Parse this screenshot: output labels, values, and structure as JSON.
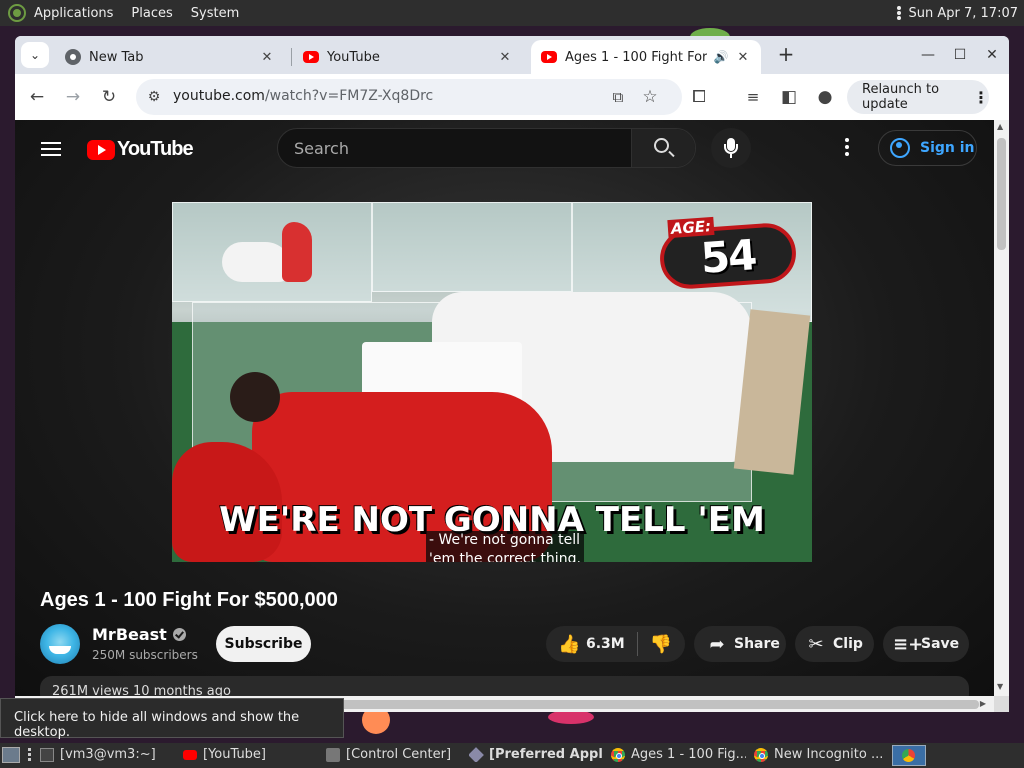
{
  "top_panel": {
    "menus": [
      "Applications",
      "Places",
      "System"
    ],
    "clock": "Sun Apr 7, 17:07"
  },
  "browser": {
    "tabs": [
      {
        "label": "New Tab",
        "icon": "chrome-icon"
      },
      {
        "label": "YouTube",
        "icon": "youtube-icon"
      },
      {
        "label": "Ages 1 - 100 Fight For $500,000",
        "icon": "youtube-icon",
        "active": true,
        "audio": true
      }
    ],
    "url_host": "youtube.com",
    "url_path": "/watch?v=FM7Z-Xq8Drc",
    "relaunch_label": "Relaunch to update"
  },
  "youtube": {
    "logo_text": "YouTube",
    "search_placeholder": "Search",
    "signin_label": "Sign in",
    "video": {
      "age_label": "AGE:",
      "age_value": "54",
      "burned_caption": "WE'RE NOT GONNA TELL 'EM",
      "cc_line1": "- We're not gonna tell",
      "cc_line2": "'em the correct thing."
    },
    "title": "Ages 1 - 100 Fight For $500,000",
    "channel": {
      "name": "MrBeast",
      "subscribers": "250M subscribers",
      "subscribe_label": "Subscribe"
    },
    "actions": {
      "likes": "6.3M",
      "share": "Share",
      "clip": "Clip",
      "save": "Save"
    },
    "description_peek": "261M views  10 months ago"
  },
  "tooltip": "Click here to hide all windows and show the desktop.",
  "taskbar": {
    "items": [
      {
        "label": "[vm3@vm3:~]"
      },
      {
        "label": "[YouTube]"
      },
      {
        "label": "[Control Center]"
      },
      {
        "label": "[Preferred Appl..."
      },
      {
        "label": "Ages 1 - 100 Fig..."
      },
      {
        "label": "New Incognito ..."
      }
    ]
  },
  "colors": {
    "youtube_red": "#ff0000",
    "signin_blue": "#3ea6ff",
    "page_bg": "#0f0f0f",
    "chrome_frame": "#dfe3eb"
  }
}
